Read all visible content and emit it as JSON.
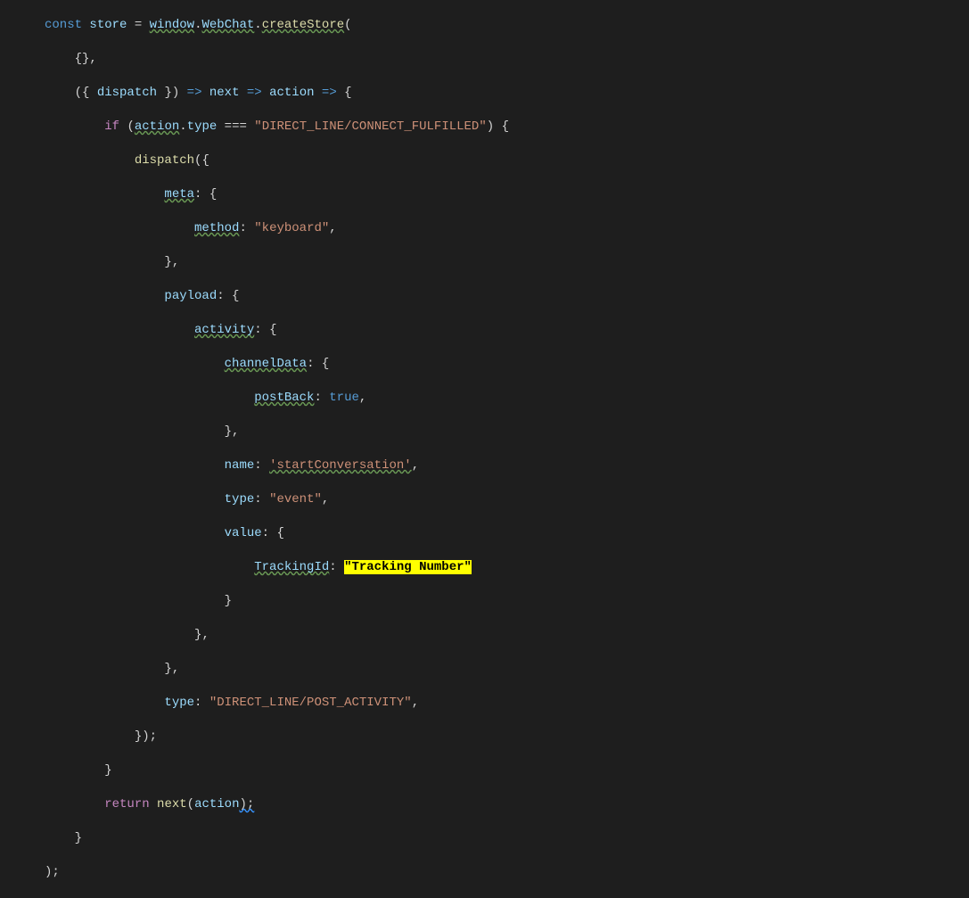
{
  "tokens": {
    "const": "const",
    "store": "store",
    "eq": " = ",
    "window": "window",
    "dot": ".",
    "WebChat": "WebChat",
    "createStore": "createStore",
    "lparen": "(",
    "rparen": ")",
    "lbrace": "{",
    "rbrace": "}",
    "comma": ",",
    "dispatch": "dispatch",
    "arrow": " => ",
    "next": "next",
    "action": "action",
    "if": "if",
    "type": "type",
    "tripleeq": " === ",
    "connectFulfilled": "\"DIRECT_LINE/CONNECT_FULFILLED\"",
    "meta": "meta",
    "colon": ": ",
    "method": "method",
    "keyboard": "\"keyboard\"",
    "payload": "payload",
    "activity": "activity",
    "channelData": "channelData",
    "postBack": "postBack",
    "true": "true",
    "name": "name",
    "startConversation": "'startConversation'",
    "typeKey": "type",
    "event": "\"event\"",
    "value": "value",
    "trackingId": "TrackingId",
    "trackingNumber": "\"Tracking Number\"",
    "postActivity": "\"DIRECT_LINE/POST_ACTIVITY\"",
    "return": "return",
    "semi": ";",
    "rparenSemi": ");"
  }
}
